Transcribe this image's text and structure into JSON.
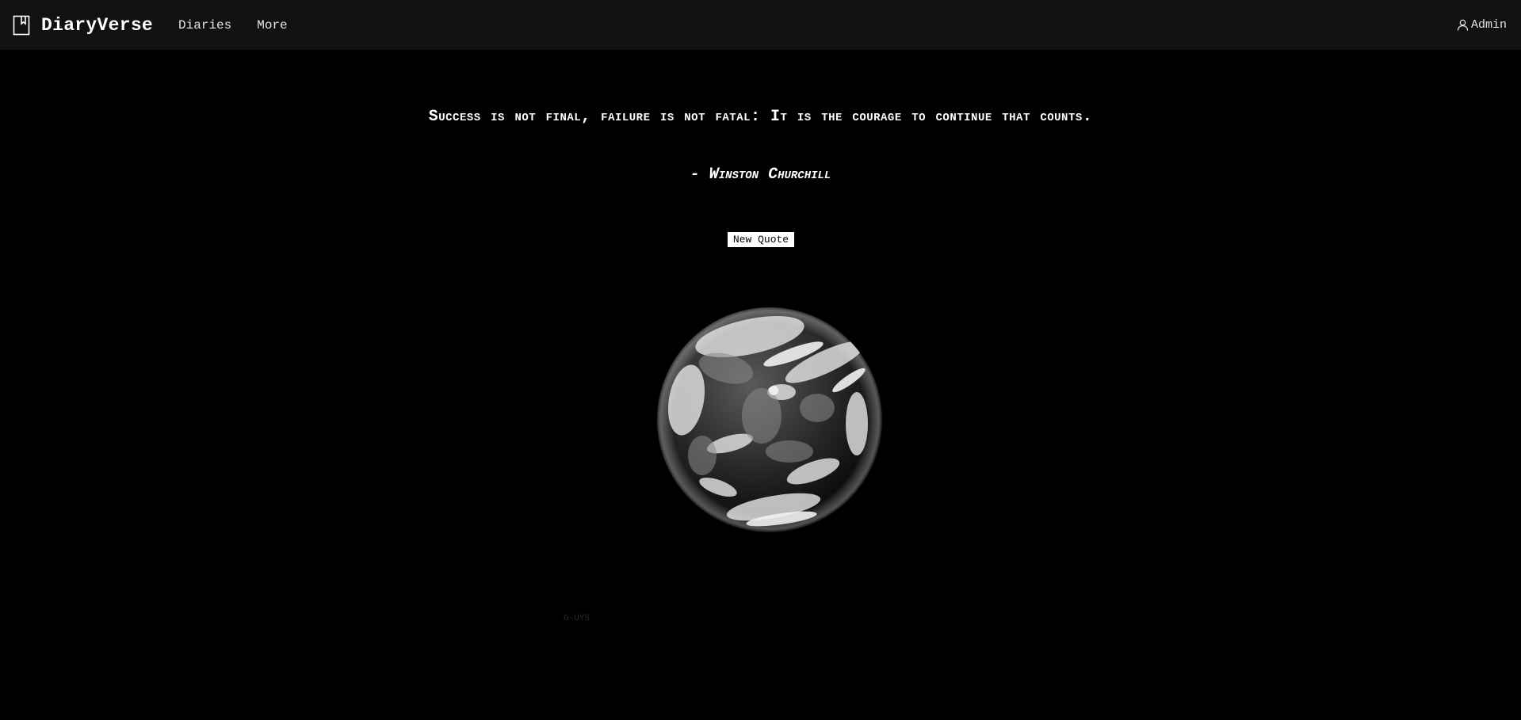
{
  "nav": {
    "brand": "DiaryVerse",
    "links": [
      "Diaries",
      "More"
    ],
    "user_label": "Admin"
  },
  "quote": {
    "text": "Success is not final, failure is not fatal: It is the courage to continue that counts.",
    "author": "- Winston Churchill",
    "button_label": "New Quote"
  },
  "footer": {
    "mark": "G-UYS"
  },
  "icons": {
    "brand": "bookmark-book-icon",
    "user": "user-icon"
  },
  "colors": {
    "background": "#000000",
    "navbar": "#111111",
    "text": "#ffffff",
    "button_bg": "#ffffff",
    "button_text": "#000000"
  }
}
